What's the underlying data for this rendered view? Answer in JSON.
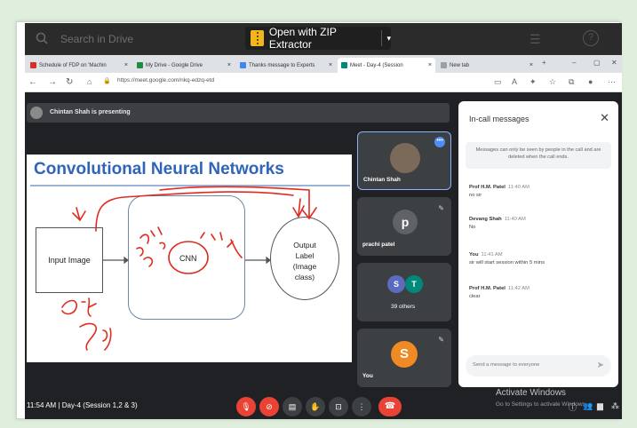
{
  "drive_bar": {
    "search_placeholder": "Search in Drive",
    "zip_button_label": "Open with ZIP Extractor",
    "caret": "▾"
  },
  "browser": {
    "tabs": [
      {
        "label": "Schedule of FDP on 'Machin",
        "icon_color": "#d93025"
      },
      {
        "label": "My Drive - Google Drive",
        "icon_color": "#1e8e3e"
      },
      {
        "label": "Thanks message to Experts",
        "icon_color": "#4285f4"
      },
      {
        "label": "Meet - Day-4 (Session",
        "icon_color": "#00897b"
      },
      {
        "label": "New tab",
        "icon_color": "#9aa0a6"
      }
    ],
    "url": "https://meet.google.com/nkq-edzq-etd"
  },
  "meet": {
    "presenting_text": "Chintan Shah is presenting",
    "slide": {
      "title": "Convolutional Neural Networks",
      "input_label": "Input Image",
      "cnn_label": "CNN",
      "output_label": [
        "Output",
        "Label",
        "(Image",
        "class)"
      ]
    },
    "tiles": {
      "chintan": {
        "name": "Chintan Shah"
      },
      "prachi": {
        "name": "prachi patel",
        "initial": "p"
      },
      "others": {
        "label": "39 others",
        "initials": [
          "S",
          "T"
        ]
      },
      "you": {
        "name": "You",
        "initial": "S"
      }
    },
    "chat": {
      "title": "In-call messages",
      "note": "Messages can only be seen by people in the call and are deleted when the call ends.",
      "messages": [
        {
          "sender": "Prof H.M. Patel",
          "time": "11:40 AM",
          "text": "no sir"
        },
        {
          "sender": "Devang Shah",
          "time": "11:40 AM",
          "text": "No"
        },
        {
          "sender": "You",
          "time": "11:41 AM",
          "text": "sir will start session within 5 mins"
        },
        {
          "sender": "Prof H.M. Patel",
          "time": "11:42 AM",
          "text": "clear"
        }
      ],
      "input_placeholder": "Send a message to everyone"
    },
    "bottom": {
      "clock_meeting": "11:54 AM  |  Day-4 (Session 1,2 & 3)"
    }
  },
  "overlay": {
    "activate_title": "Activate Windows",
    "activate_sub": "Go to Settings to activate Windows."
  },
  "colors": {
    "accent": "#1a73e8",
    "end_call": "#ea4335",
    "slide_title": "#2f64b8"
  }
}
